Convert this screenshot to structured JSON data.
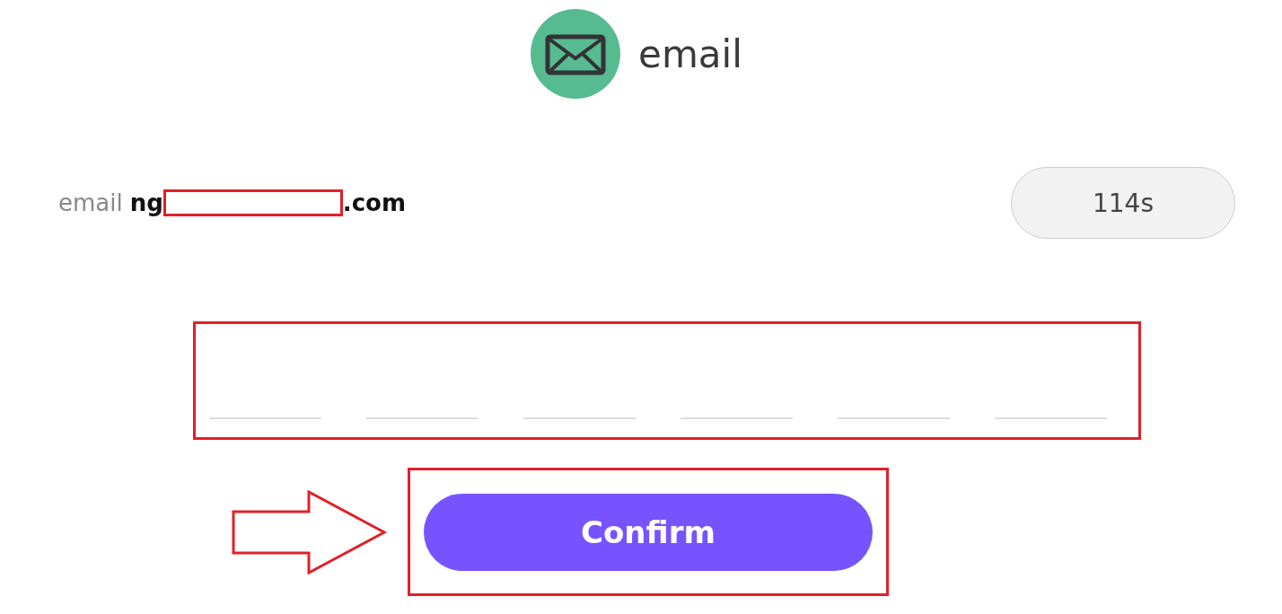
{
  "header": {
    "title": "email"
  },
  "email_line": {
    "label": "email",
    "value_start": "ng",
    "value_end": ".com"
  },
  "timer": "114s",
  "code_fields": [
    {
      "filled": false
    },
    {
      "filled": false
    },
    {
      "filled": false
    },
    {
      "filled": false
    },
    {
      "filled": false
    },
    {
      "filled": false
    }
  ],
  "confirm_button": "Confirm"
}
